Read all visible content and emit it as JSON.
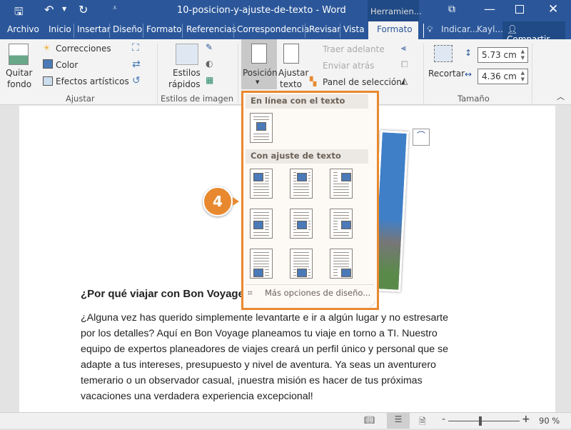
{
  "titlebar": {
    "doc_title": "10-posicion-y-ajuste-de-texto  -  Word",
    "context_tab": "Herramien...",
    "colors": {
      "bar": "#2b579a",
      "accent": "#e8892f"
    }
  },
  "tabs": [
    "Archivo",
    "Inicio",
    "Insertar",
    "Diseño",
    "Formato",
    "Referencias",
    "Correspondencia",
    "Revisar",
    "Vista",
    "Formato"
  ],
  "tabs_right": {
    "tell_me": "Indicar...",
    "user": "Kayl...",
    "share": "Compartir"
  },
  "ribbon": {
    "quitar_fondo": [
      "Quitar",
      "fondo"
    ],
    "correcciones": "Correcciones",
    "color": "Color",
    "efectos": "Efectos artísticos",
    "ajustar_group": "Ajustar",
    "estilos": [
      "Estilos",
      "rápidos"
    ],
    "estilos_group": "Estilos de imagen",
    "posicion": "Posición",
    "ajustar_texto": [
      "Ajustar",
      "texto"
    ],
    "traer": "Traer adelante",
    "enviar": "Enviar atrás",
    "panel": "Panel de selección",
    "recortar": "Recortar",
    "height": "5.73 cm",
    "width": "4.36 cm",
    "tamano_group": "Tamaño"
  },
  "dropdown": {
    "section1": "En línea con el texto",
    "section2": "Con ajuste de texto",
    "more": "Más opciones de diseño..."
  },
  "callout": "4",
  "document": {
    "heading": "¿Por qué viajar con Bon Voyage?",
    "lines": [
      "¿Alguna vez has querido simplemente  levantarte e ir a algún lugar y no estresarte",
      "por los detalles?  Aquí en Bon Voyage planeamos tu viaje en torno a TI. Nuestro",
      "equipo de expertos planeadores de viajes creará un perfil único y personal que se",
      "adapte a tus intereses, presupuesto y nivel de aventura. Ya seas un aventurero",
      "temerario o un observador casual, ¡nuestra misión es hacer de tus próximas",
      "vacaciones una verdadera experiencia excepcional!"
    ]
  },
  "status": {
    "zoom": "90 %",
    "zoom_level_percent": 90
  }
}
